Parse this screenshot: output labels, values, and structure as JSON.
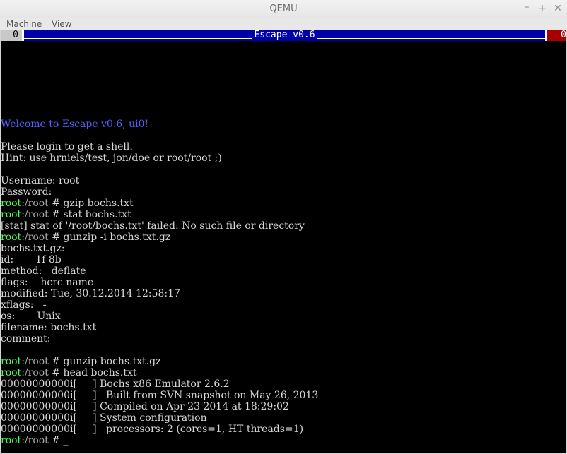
{
  "window": {
    "title": "QEMU",
    "minimize": "–",
    "maximize": "+",
    "close": "✕"
  },
  "menu": {
    "machine": "Machine",
    "view": "View"
  },
  "header": {
    "left_num": "0",
    "name": "Escape v0.6",
    "right_num": "0"
  },
  "terminal": {
    "welcome": "Welcome to Escape v0.6, ui0!",
    "login_msg": "Please login to get a shell.",
    "hint": "Hint: use hrniels/test, jon/doe or root/root ;)",
    "username": "Username: root",
    "password": "Password:",
    "prompt_user": "root",
    "prompt_path": ":/root",
    "prompt_sym": " # ",
    "cmd1": "gzip bochs.txt",
    "cmd2": "stat bochs.txt",
    "err": "[stat] stat of '/root/bochs.txt' failed: No such file or directory",
    "cmd3": "gunzip -i bochs.txt.gz",
    "info": [
      "bochs.txt.gz:",
      "id:       1f 8b",
      "method:   deflate",
      "flags:    hcrc name",
      "modified: Tue, 30.12.2014 12:58:17",
      "xflags:   -",
      "os:       Unix",
      "filename: bochs.txt",
      "comment:"
    ],
    "cmd4": "gunzip bochs.txt.gz",
    "cmd5": "head bochs.txt",
    "head": [
      "00000000000i[     ] Bochs x86 Emulator 2.6.2",
      "00000000000i[     ]   Built from SVN snapshot on May 26, 2013",
      "00000000000i[     ] Compiled on Apr 23 2014 at 18:29:02",
      "00000000000i[     ] System configuration",
      "00000000000i[     ]   processors: 2 (cores=1, HT threads=1)"
    ],
    "cursor": "_"
  }
}
